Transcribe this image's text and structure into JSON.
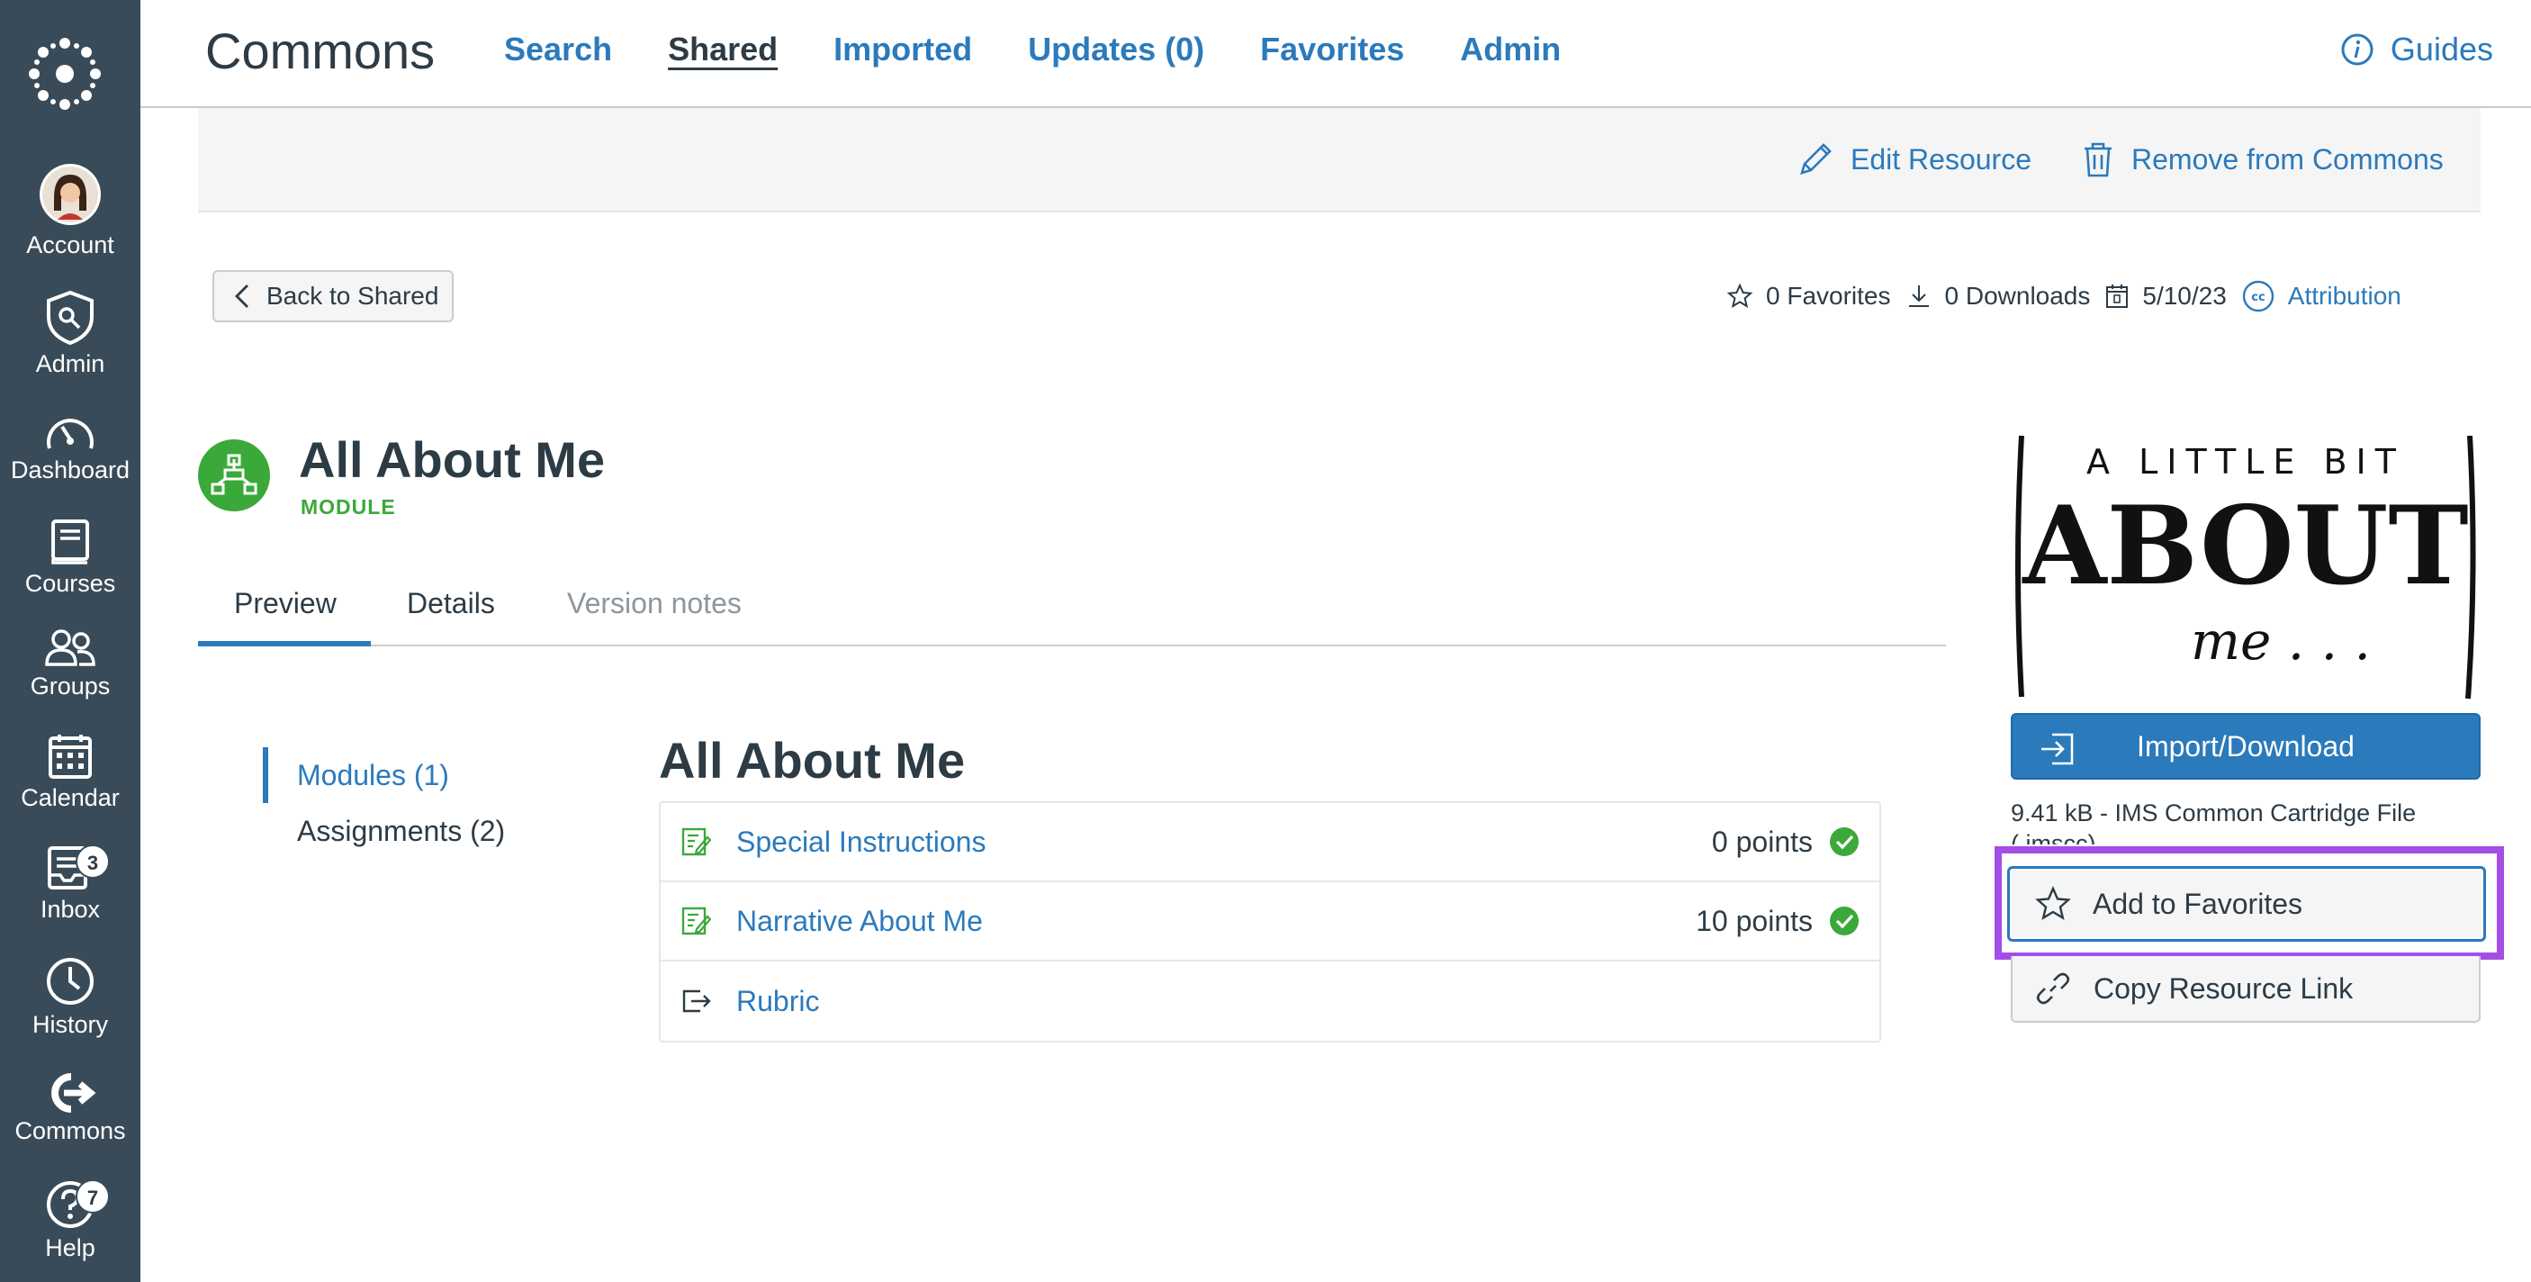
{
  "global_nav": {
    "items": [
      {
        "label": "Account",
        "icon": "avatar"
      },
      {
        "label": "Admin",
        "icon": "shield-icon"
      },
      {
        "label": "Dashboard",
        "icon": "dashboard-icon"
      },
      {
        "label": "Courses",
        "icon": "book-icon"
      },
      {
        "label": "Groups",
        "icon": "groups-icon"
      },
      {
        "label": "Calendar",
        "icon": "calendar-icon"
      },
      {
        "label": "Inbox",
        "icon": "inbox-icon",
        "badge": "3"
      },
      {
        "label": "History",
        "icon": "clock-icon"
      },
      {
        "label": "Commons",
        "icon": "commons-icon"
      },
      {
        "label": "Help",
        "icon": "help-icon",
        "badge": "7"
      }
    ]
  },
  "header": {
    "title": "Commons",
    "nav": [
      "Search",
      "Shared",
      "Imported",
      "Updates (0)",
      "Favorites",
      "Admin"
    ],
    "active": "Shared",
    "guides_label": "Guides"
  },
  "actions": {
    "edit_label": "Edit Resource",
    "remove_label": "Remove from Commons"
  },
  "back_label": "Back to Shared",
  "stats": {
    "favorites": "0 Favorites",
    "downloads": "0 Downloads",
    "date": "5/10/23",
    "attribution": "Attribution"
  },
  "resource": {
    "title": "All About Me",
    "type": "MODULE"
  },
  "tabs": [
    "Preview",
    "Details",
    "Version notes"
  ],
  "sidebar": {
    "items": [
      "Modules (1)",
      "Assignments (2)"
    ]
  },
  "module": {
    "title": "All About Me",
    "items": [
      {
        "title": "Special Instructions",
        "points": "0 points",
        "icon": "assignment-icon",
        "published": true
      },
      {
        "title": "Narrative About Me",
        "points": "10 points",
        "icon": "assignment-icon",
        "published": true
      },
      {
        "title": "Rubric",
        "points": "",
        "icon": "external-link-icon",
        "published": false
      }
    ]
  },
  "thumbnail": {
    "line1": "A LITTLE BIT",
    "line2": "ABOUT",
    "line3": "me . . ."
  },
  "right": {
    "import_label": "Import/Download",
    "file_info": "9.41 kB - IMS Common Cartridge File (.imscc)",
    "favorite_label": "Add to Favorites",
    "copy_label": "Copy Resource Link"
  },
  "colors": {
    "nav_bg": "#394b58",
    "link": "#2b7abc",
    "success": "#3aa93a",
    "highlight": "#a44ee6"
  }
}
